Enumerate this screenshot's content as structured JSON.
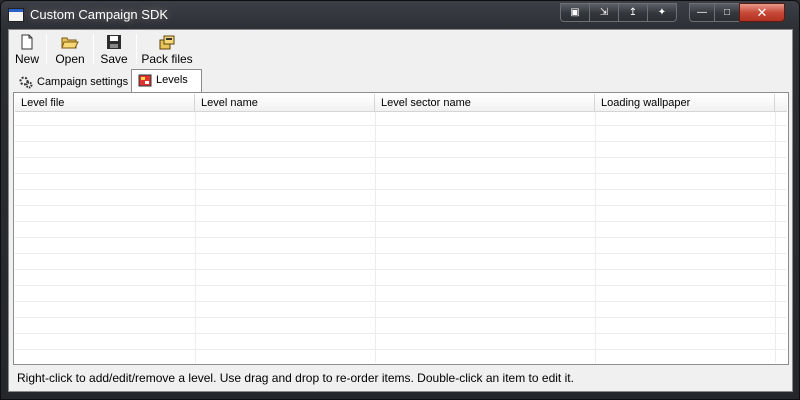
{
  "window": {
    "title": "Custom Campaign SDK",
    "title_buttons": [
      "restore-icon",
      "fullscreen-icon",
      "pin-up-icon",
      "pin-icon",
      "minimize-icon",
      "maximize-icon",
      "close-icon"
    ]
  },
  "toolbar": {
    "new_label": "New",
    "open_label": "Open",
    "save_label": "Save",
    "pack_label": "Pack files"
  },
  "tabs": [
    {
      "label": "Campaign settings",
      "icon": "gears-icon",
      "active": false
    },
    {
      "label": "Levels",
      "icon": "levels-icon",
      "active": true
    }
  ],
  "table": {
    "columns": [
      "Level file",
      "Level name",
      "Level sector name",
      "Loading wallpaper"
    ],
    "rows": []
  },
  "status": {
    "text": "Right-click to add/edit/remove a level. Use drag and drop to re-order items. Double-click an item to edit it."
  }
}
